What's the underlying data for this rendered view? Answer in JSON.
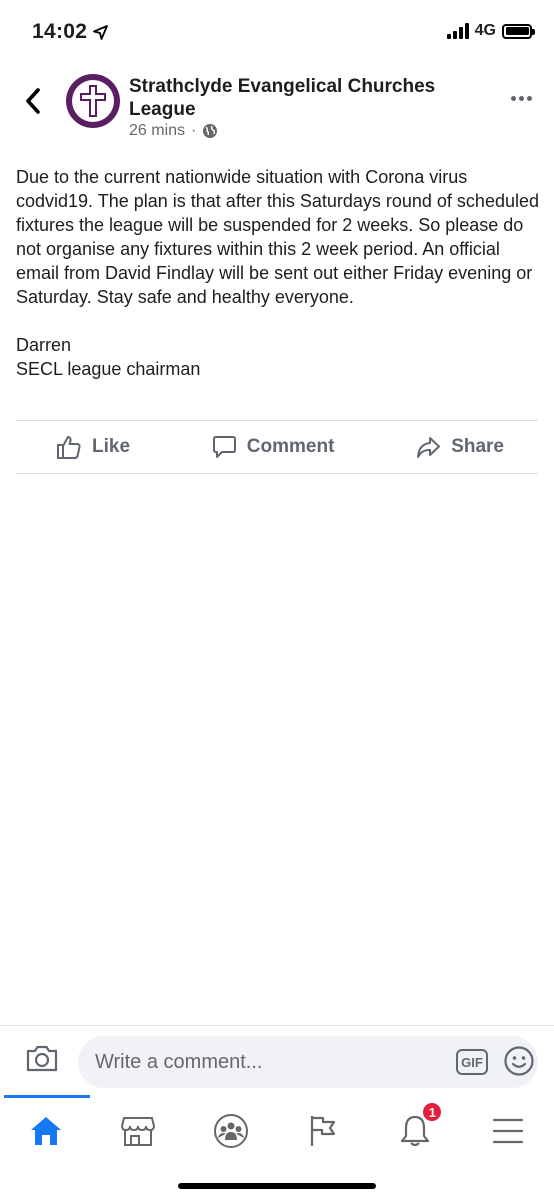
{
  "status_bar": {
    "time": "14:02",
    "network": "4G"
  },
  "post": {
    "page_name": "Strathclyde Evangelical Churches League",
    "timestamp": "26 mins",
    "separator": "·",
    "body_paragraphs": [
      "Due to the current nationwide situation with Corona virus codvid19. The plan is that after this Saturdays round of scheduled fixtures the league will be suspended for 2 weeks. So please do not organise any fixtures within this 2 week period. An official email from David Findlay will be sent out either Friday evening or Saturday. Stay safe and healthy everyone.",
      "Darren\nSECL league chairman"
    ]
  },
  "actions": {
    "like_label": "Like",
    "comment_label": "Comment",
    "share_label": "Share"
  },
  "composer": {
    "placeholder": "Write a comment...",
    "gif_label": "GIF"
  },
  "tab_bar": {
    "notifications_count": "1",
    "active_color": "#1877f2",
    "inactive_color": "#65676b"
  }
}
